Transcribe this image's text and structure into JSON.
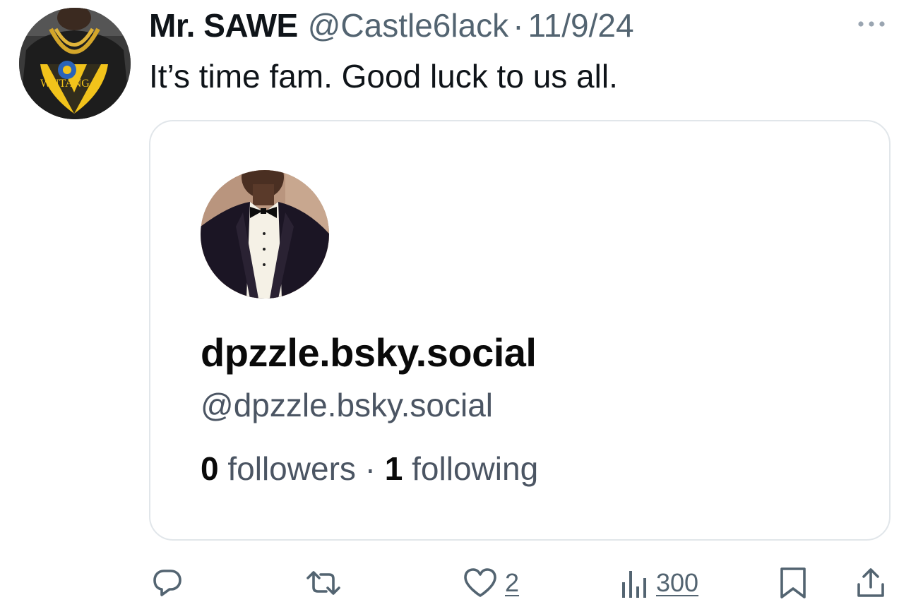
{
  "author": {
    "name": "Mr. SAWE",
    "handle": "@Castle6lack",
    "separator": "·",
    "date": "11/9/24",
    "avatar_icon": "avatar-photo"
  },
  "tweet": {
    "text": "It’s time fam. Good luck to us all."
  },
  "card": {
    "display_name": "dpzzle.bsky.social",
    "handle": "@dpzzle.bsky.social",
    "followers_count": "0",
    "followers_label": "followers",
    "separator": "·",
    "following_count": "1",
    "following_label": "following"
  },
  "actions": {
    "reply_icon": "reply-icon",
    "retweet_icon": "retweet-icon",
    "like_icon": "heart-icon",
    "like_count": "2",
    "views_icon": "views-icon",
    "views_count": "300",
    "bookmark_icon": "bookmark-icon",
    "share_icon": "share-icon"
  },
  "colors": {
    "text_primary": "#0f1419",
    "text_secondary": "#536471",
    "card_border": "#e1e6ea"
  }
}
